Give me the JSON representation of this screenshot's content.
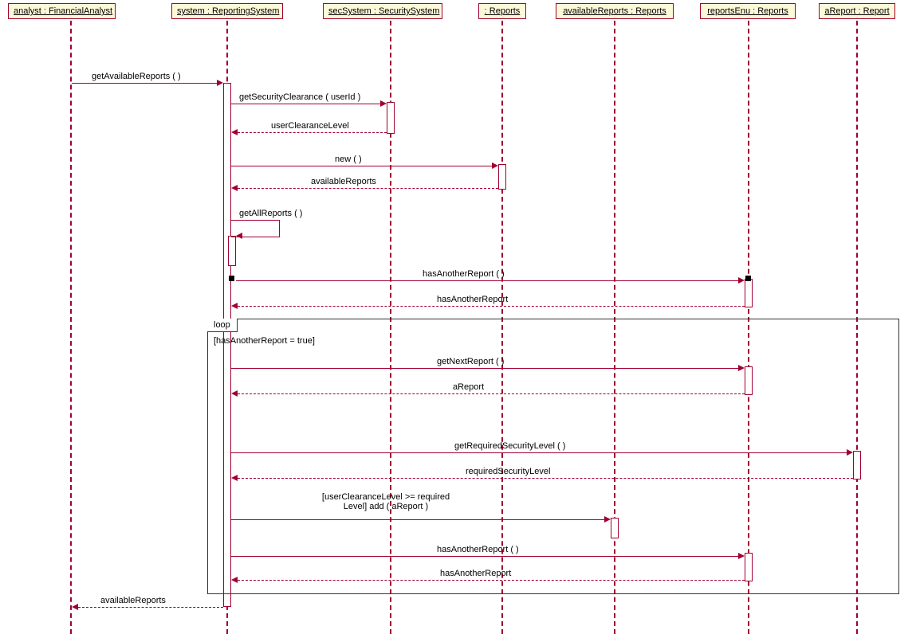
{
  "participants": {
    "analyst": "analyst : FinancialAnalyst",
    "system": "system : ReportingSystem",
    "secSystem": "secSystem : SecuritySystem",
    "reports": "  : Reports",
    "availableReports": "availableReports : Reports",
    "reportsEnu": "reportsEnu : Reports",
    "aReport": "aReport : Report"
  },
  "messages": {
    "m1": "getAvailableReports (  )",
    "m2": "getSecurityClearance ( userId )",
    "r2": "userClearanceLevel",
    "m3": "new (  )",
    "r3": "availableReports",
    "m4": "getAllReports (  )",
    "m5": "hasAnotherReport (  )",
    "r5": "hasAnotherReport",
    "m6": "getNextReport (  )",
    "r6": "aReport",
    "m7": "getRequiredSecurityLevel (  )",
    "r7": "requiredSecurityLevel",
    "m8a": "[userClearanceLevel >= required",
    "m8b": "Level] add ( aReport )",
    "m9": "hasAnotherReport (  )",
    "r9": "hasAnotherReport",
    "r10": "availableReports"
  },
  "loop": {
    "label": "loop",
    "condition": "[hasAnotherReport = true]"
  }
}
